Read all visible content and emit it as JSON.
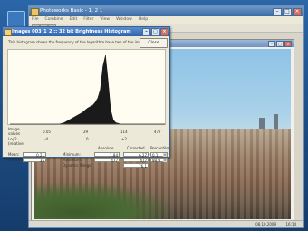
{
  "window": {
    "title": "Photoworks Basic - 1, 2 1",
    "menu": [
      "File",
      "Combine",
      "Edit",
      "Filter",
      "View",
      "Window",
      "Help"
    ]
  },
  "status": {
    "date": "08.10.2009",
    "time": "16:14"
  },
  "dialog": {
    "title": "Images 003_1_2 :: 32 bit Brightness Histogram",
    "description": "This histogram shows the frequency of the logarithm base two of the image values",
    "close_label": "Close",
    "axis": {
      "label_line1": "Image",
      "label_line2": "values",
      "log2_label": "Log2",
      "relative_label": "(relative)",
      "ticks": [
        "0.05",
        "29",
        "114",
        "477"
      ],
      "log_ticks": [
        "-4",
        "0",
        "+2"
      ]
    },
    "stats": {
      "mean_label": "Mean:",
      "mean_value": "0.21",
      "median_label": "Median:",
      "median_value": "35",
      "absolute_header": "Absolute",
      "corrected_header": "Corrected",
      "percentiles_header": "Percentiles",
      "minimum_label": "Minimum:",
      "minimum_absolute": "1.84",
      "minimum_corrected": "6.27",
      "minimum_percentile": "0.1",
      "maximum_label": "Maximum:",
      "maximum_absolute": "477",
      "maximum_corrected": "477",
      "maximum_percentile": "99.9",
      "dynamic_label": "Dynamic Range:",
      "dynamic_value": "76.1"
    }
  },
  "chart_data": {
    "type": "area",
    "x": [
      0,
      1,
      2,
      3,
      4,
      5,
      6,
      7,
      8,
      9,
      10,
      11,
      12,
      13,
      14,
      15,
      16,
      17,
      18,
      19,
      20,
      21,
      22,
      23,
      24,
      25,
      26,
      27,
      28,
      29,
      30,
      31,
      32,
      33,
      34,
      35,
      36,
      37,
      38,
      39,
      40,
      41,
      42,
      43,
      44,
      45,
      46,
      47,
      48,
      49,
      50,
      51,
      52,
      53,
      54,
      55,
      56,
      57,
      58,
      59,
      60
    ],
    "values": [
      0,
      0,
      0,
      0,
      0,
      0,
      0,
      0,
      0,
      0,
      0,
      0,
      0,
      0,
      0,
      0,
      0,
      0,
      0,
      0,
      1,
      2,
      4,
      6,
      8,
      10,
      12,
      14,
      16,
      19,
      22,
      24,
      26,
      30,
      36,
      48,
      80,
      95,
      60,
      20,
      6,
      2,
      1,
      0,
      0,
      0,
      0,
      0,
      0,
      0,
      0,
      0,
      0,
      0,
      0,
      0,
      0,
      0,
      0,
      0,
      0
    ],
    "ylim": [
      0,
      100
    ]
  },
  "colors": {
    "histogram": "#1a1a1a",
    "dialog_title": "#2f64ad"
  }
}
